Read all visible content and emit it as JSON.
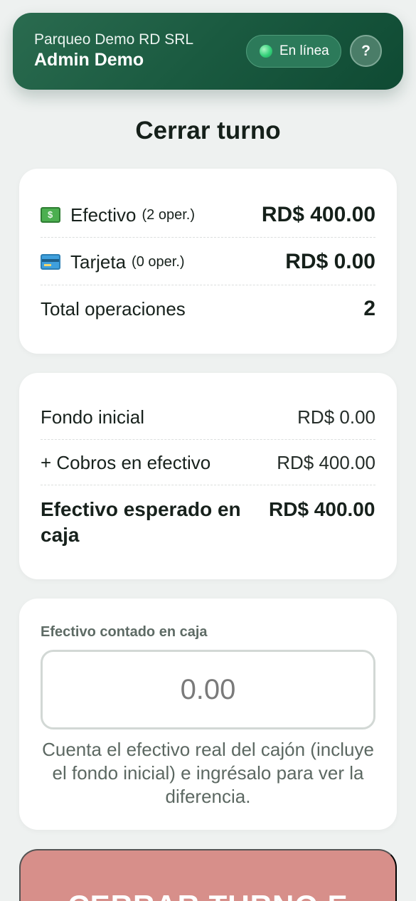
{
  "header": {
    "company": "Parqueo Demo RD SRL",
    "user": "Admin Demo",
    "status_label": "En línea",
    "help_label": "?"
  },
  "page": {
    "title": "Cerrar turno"
  },
  "summary": {
    "cash": {
      "label": "Efectivo",
      "ops": "(2 oper.)",
      "amount": "RD$ 400.00",
      "icon": "cash-icon"
    },
    "card": {
      "label": "Tarjeta",
      "ops": "(0 oper.)",
      "amount": "RD$ 0.00",
      "icon": "credit-card-icon"
    },
    "total": {
      "label": "Total operaciones",
      "value": "2"
    }
  },
  "reconciliation": {
    "initial_fund": {
      "label": "Fondo inicial",
      "value": "RD$ 0.00"
    },
    "cash_collected": {
      "label": "+ Cobros en efectivo",
      "value": "RD$ 400.00"
    },
    "expected": {
      "label": "Efectivo esperado en caja",
      "value": "RD$ 400.00"
    }
  },
  "count": {
    "label": "Efectivo contado en caja",
    "placeholder": "0.00",
    "value": "",
    "hint": "Cuenta el efectivo real del cajón (incluye el fondo inicial) e ingrésalo para ver la diferencia."
  },
  "action": {
    "close_label": "CERRAR TURNO E"
  },
  "colors": {
    "header_start": "#2a6b4f",
    "header_end": "#0f4a33",
    "status_dot": "#34d17a",
    "close_button": "#d78f8a",
    "background": "#eef1f0"
  }
}
